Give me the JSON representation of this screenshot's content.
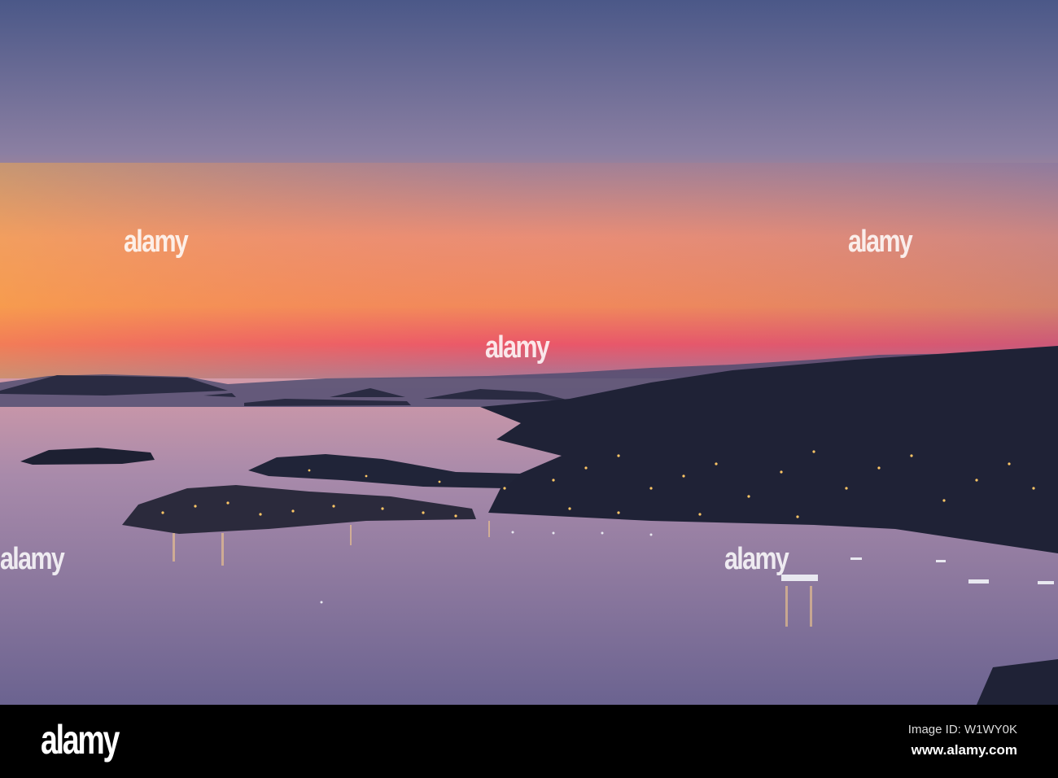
{
  "watermark": {
    "text": "alamy"
  },
  "footer": {
    "logo": "alamy",
    "image_id": "Image ID: W1WY0K",
    "url": "www.alamy.com"
  },
  "colors": {
    "sky_top": "#4b5888",
    "sky_mid": "#8b7fa2",
    "sunset_orange": "#f6a04e",
    "sunset_pink": "#e8526a",
    "sea_top": "#c08fa8",
    "sea_bottom": "#6b6390",
    "land": "#1f2236",
    "lights": "#ffc766"
  }
}
